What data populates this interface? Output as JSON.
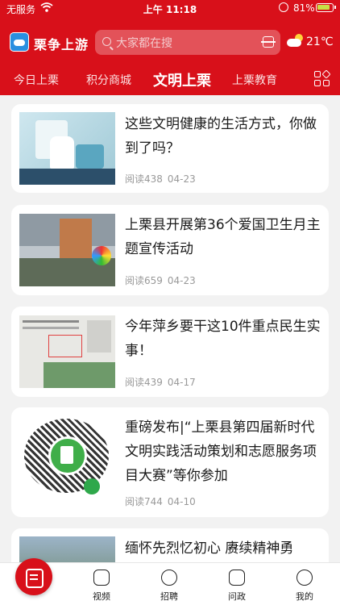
{
  "status_bar": {
    "carrier": "无服务",
    "time": "上午 11:18",
    "battery": "81%"
  },
  "header": {
    "app_name": "栗争上游",
    "search_placeholder": "大家都在搜",
    "temperature": "21℃"
  },
  "tabs": [
    "今日上栗",
    "积分商城",
    "文明上栗",
    "上栗教育"
  ],
  "active_tab": "文明上栗",
  "articles": [
    {
      "title": "这些文明健康的生活方式，你做到了吗？",
      "reads": "阅读438",
      "date": "04-23"
    },
    {
      "title": "上栗县开展第36个爱国卫生月主题宣传活动",
      "reads": "阅读659",
      "date": "04-23"
    },
    {
      "title": "今年萍乡要干这10件重点民生实事！",
      "reads": "阅读439",
      "date": "04-17"
    },
    {
      "title": "重磅发布|“上栗县第四届新时代文明实践活动策划和志愿服务项目大赛”等你参加",
      "reads": "阅读744",
      "date": "04-10"
    },
    {
      "title": "缅怀先烈忆初心 赓续精神勇",
      "reads": "",
      "date": ""
    }
  ],
  "tabbar": [
    {
      "label": "视频",
      "icon": "video-icon"
    },
    {
      "label": "招聘",
      "icon": "chat-icon"
    },
    {
      "label": "问政",
      "icon": "question-icon"
    },
    {
      "label": "我的",
      "icon": "profile-icon"
    }
  ],
  "colors": {
    "brand_red": "#d8101a",
    "background": "#f2f2f2"
  }
}
